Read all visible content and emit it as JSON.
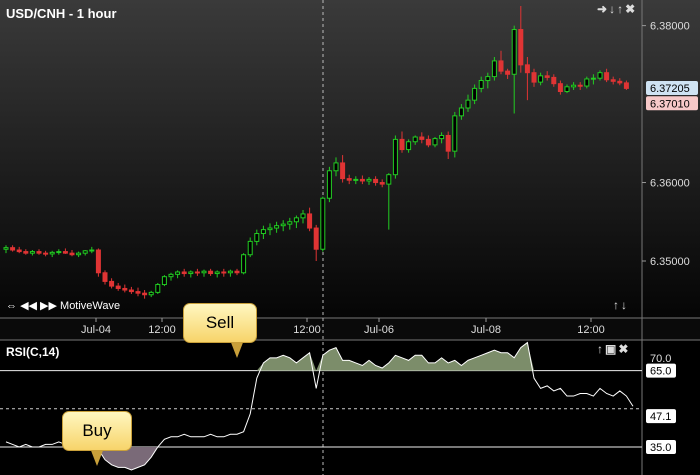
{
  "window": {
    "brand": "MotiveWave"
  },
  "price_panel": {
    "title": "USD/CNH - 1 hour",
    "icons": [
      "arrow-right-icon",
      "arrow-down-icon",
      "arrow-up-icon",
      "close-icon"
    ],
    "scroll_icons": [
      "arrow-up-icon",
      "arrow-down-icon"
    ],
    "current_price_tag": "6.37205",
    "bid_price_tag": "6.37010"
  },
  "rsi_panel": {
    "title": "RSI(C,14)",
    "icons": [
      "arrow-up-icon",
      "maximize-icon",
      "close-icon"
    ]
  },
  "callouts": {
    "sell": "Sell",
    "buy": "Buy"
  },
  "colors": {
    "background": "#000000",
    "up_candle": "#22cc22",
    "down_candle": "#e03434",
    "rsi_fill": "#7c8d6a",
    "rsi_line": "#ffffff"
  },
  "chart_data": [
    {
      "type": "candlestick",
      "title": "USD/CNH - 1 hour",
      "x_ticks": [
        "Jul-04",
        "12:00",
        "12:00",
        "Jul-06",
        "Jul-08",
        "12:00"
      ],
      "y_ticks": [
        6.35,
        6.36,
        6.38
      ],
      "ylim": [
        6.3435,
        6.3825
      ],
      "grid": false,
      "annotations": [
        "6.37205",
        "6.37010"
      ],
      "candles": [
        [
          6.3515,
          6.352,
          6.351,
          6.3517
        ],
        [
          6.3517,
          6.352,
          6.3512,
          6.3514
        ],
        [
          6.3514,
          6.3518,
          6.351,
          6.3512
        ],
        [
          6.3512,
          6.3515,
          6.3508,
          6.351
        ],
        [
          6.351,
          6.3514,
          6.3507,
          6.3512
        ],
        [
          6.3512,
          6.3515,
          6.3508,
          6.351
        ],
        [
          6.351,
          6.3513,
          6.3506,
          6.3509
        ],
        [
          6.3509,
          6.3513,
          6.3505,
          6.3511
        ],
        [
          6.3511,
          6.3515,
          6.3508,
          6.3512
        ],
        [
          6.3512,
          6.3516,
          6.3509,
          6.351
        ],
        [
          6.351,
          6.3514,
          6.3506,
          6.3508
        ],
        [
          6.3508,
          6.3512,
          6.3505,
          6.351
        ],
        [
          6.351,
          6.3514,
          6.3507,
          6.3513
        ],
        [
          6.3513,
          6.3518,
          6.351,
          6.3514
        ],
        [
          6.3514,
          6.3516,
          6.348,
          6.3485
        ],
        [
          6.3485,
          6.3488,
          6.347,
          6.3474
        ],
        [
          6.3474,
          6.3478,
          6.3465,
          6.3468
        ],
        [
          6.3468,
          6.3472,
          6.3462,
          6.3465
        ],
        [
          6.3465,
          6.347,
          6.346,
          6.3463
        ],
        [
          6.3463,
          6.3467,
          6.3458,
          6.3461
        ],
        [
          6.3461,
          6.3466,
          6.3455,
          6.3459
        ],
        [
          6.3459,
          6.3463,
          6.3452,
          6.3457
        ],
        [
          6.3457,
          6.3462,
          6.3454,
          6.346
        ],
        [
          6.346,
          6.3472,
          6.3458,
          6.347
        ],
        [
          6.347,
          6.3482,
          6.3468,
          6.348
        ],
        [
          6.348,
          6.3485,
          6.3475,
          6.3483
        ],
        [
          6.3483,
          6.3488,
          6.3478,
          6.3486
        ],
        [
          6.3486,
          6.349,
          6.348,
          6.3484
        ],
        [
          6.3484,
          6.3488,
          6.3479,
          6.3486
        ],
        [
          6.3486,
          6.349,
          6.3481,
          6.3485
        ],
        [
          6.3485,
          6.3489,
          6.348,
          6.3487
        ],
        [
          6.3487,
          6.349,
          6.3481,
          6.3484
        ],
        [
          6.3484,
          6.3488,
          6.3479,
          6.3486
        ],
        [
          6.3486,
          6.349,
          6.348,
          6.3485
        ],
        [
          6.3485,
          6.3489,
          6.348,
          6.3487
        ],
        [
          6.3487,
          6.349,
          6.3482,
          6.3485
        ],
        [
          6.3485,
          6.351,
          6.3483,
          6.3508
        ],
        [
          6.3508,
          6.353,
          6.3505,
          6.3525
        ],
        [
          6.3525,
          6.354,
          6.352,
          6.3535
        ],
        [
          6.3535,
          6.3545,
          6.3528,
          6.354
        ],
        [
          6.354,
          6.3548,
          6.3533,
          6.3542
        ],
        [
          6.3542,
          6.355,
          6.3536,
          6.3545
        ],
        [
          6.3545,
          6.3552,
          6.3538,
          6.3547
        ],
        [
          6.3547,
          6.3555,
          6.354,
          6.355
        ],
        [
          6.355,
          6.3558,
          6.3542,
          6.3555
        ],
        [
          6.3555,
          6.3565,
          6.3548,
          6.356
        ],
        [
          6.356,
          6.3568,
          6.3538,
          6.3542
        ],
        [
          6.3542,
          6.3546,
          6.35,
          6.3515
        ],
        [
          6.3515,
          6.3582,
          6.3512,
          6.358
        ],
        [
          6.358,
          6.362,
          6.3575,
          6.3615
        ],
        [
          6.3615,
          6.3632,
          6.3608,
          6.3625
        ],
        [
          6.3625,
          6.3635,
          6.36,
          6.3605
        ],
        [
          6.3605,
          6.361,
          6.3598,
          6.3603
        ],
        [
          6.3603,
          6.3608,
          6.3598,
          6.3604
        ],
        [
          6.3604,
          6.3609,
          6.3598,
          6.3602
        ],
        [
          6.3602,
          6.3607,
          6.3597,
          6.3604
        ],
        [
          6.3604,
          6.3608,
          6.3596,
          6.36
        ],
        [
          6.36,
          6.3604,
          6.3594,
          6.3598
        ],
        [
          6.3598,
          6.3612,
          6.354,
          6.361
        ],
        [
          6.361,
          6.366,
          6.3605,
          6.3655
        ],
        [
          6.3655,
          6.3665,
          6.3638,
          6.3642
        ],
        [
          6.3642,
          6.3655,
          6.3638,
          6.3652
        ],
        [
          6.3652,
          6.366,
          6.3648,
          6.3658
        ],
        [
          6.3658,
          6.3664,
          6.365,
          6.3655
        ],
        [
          6.3655,
          6.366,
          6.3645,
          6.3648
        ],
        [
          6.3648,
          6.3658,
          6.3645,
          6.3656
        ],
        [
          6.3656,
          6.3664,
          6.365,
          6.366
        ],
        [
          6.366,
          6.3665,
          6.363,
          6.364
        ],
        [
          6.364,
          6.369,
          6.3632,
          6.3685
        ],
        [
          6.3685,
          6.37,
          6.368,
          6.3695
        ],
        [
          6.3695,
          6.3712,
          6.369,
          6.3705
        ],
        [
          6.3705,
          6.3725,
          6.37,
          6.372
        ],
        [
          6.372,
          6.3735,
          6.3715,
          6.373
        ],
        [
          6.373,
          6.374,
          6.372,
          6.3735
        ],
        [
          6.3735,
          6.376,
          6.373,
          6.3755
        ],
        [
          6.3755,
          6.3768,
          6.3738,
          6.3742
        ],
        [
          6.3742,
          6.3745,
          6.3732,
          6.3738
        ],
        [
          6.3738,
          6.38,
          6.3688,
          6.3795
        ],
        [
          6.3795,
          6.3825,
          6.374,
          6.375
        ],
        [
          6.375,
          6.376,
          6.3705,
          6.374
        ],
        [
          6.374,
          6.3745,
          6.3722,
          6.3728
        ],
        [
          6.3728,
          6.374,
          6.3724,
          6.3736
        ],
        [
          6.3736,
          6.3742,
          6.373,
          6.3734
        ],
        [
          6.3734,
          6.3738,
          6.3722,
          6.3726
        ],
        [
          6.3726,
          6.373,
          6.3712,
          6.3716
        ],
        [
          6.3716,
          6.3725,
          6.3714,
          6.3722
        ],
        [
          6.3722,
          6.3728,
          6.3718,
          6.3724
        ],
        [
          6.3724,
          6.3728,
          6.3718,
          6.3723
        ],
        [
          6.3723,
          6.3735,
          6.372,
          6.3732
        ],
        [
          6.3732,
          6.3738,
          6.3725,
          6.3733
        ],
        [
          6.3733,
          6.3743,
          6.373,
          6.374
        ],
        [
          6.374,
          6.3745,
          6.3728,
          6.3731
        ],
        [
          6.3731,
          6.3735,
          6.3725,
          6.3729
        ],
        [
          6.3729,
          6.3733,
          6.3724,
          6.3727
        ],
        [
          6.3727,
          6.373,
          6.3718,
          6.372
        ]
      ]
    },
    {
      "type": "line",
      "title": "RSI(C,14)",
      "y_ticks": [
        70.0,
        47.1,
        35.0
      ],
      "ylim": [
        24,
        77
      ],
      "reference_lines": [
        65.0,
        35.0
      ],
      "midline": 50,
      "current_value": 47.1,
      "annotations": [
        "Buy",
        "Sell"
      ],
      "values": [
        37,
        36,
        35,
        36,
        35,
        35,
        36,
        36,
        37,
        36,
        35,
        36,
        37,
        36,
        34,
        30,
        28,
        27,
        27,
        26,
        27,
        28,
        31,
        35,
        38,
        39,
        39,
        40,
        39,
        39,
        39,
        40,
        39,
        39,
        40,
        40,
        41,
        48,
        62,
        68,
        70,
        70,
        71,
        70,
        68,
        70,
        72,
        58,
        71,
        73,
        74,
        69,
        69,
        68,
        67,
        69,
        67,
        66,
        68,
        71,
        70,
        69,
        71,
        71,
        68,
        68,
        70,
        68,
        69,
        67,
        69,
        70,
        71,
        72,
        73,
        72,
        72,
        70,
        74,
        76,
        62,
        58,
        59,
        57,
        58,
        55,
        55,
        56,
        56,
        55,
        58,
        56,
        55,
        57,
        55,
        51
      ]
    }
  ]
}
